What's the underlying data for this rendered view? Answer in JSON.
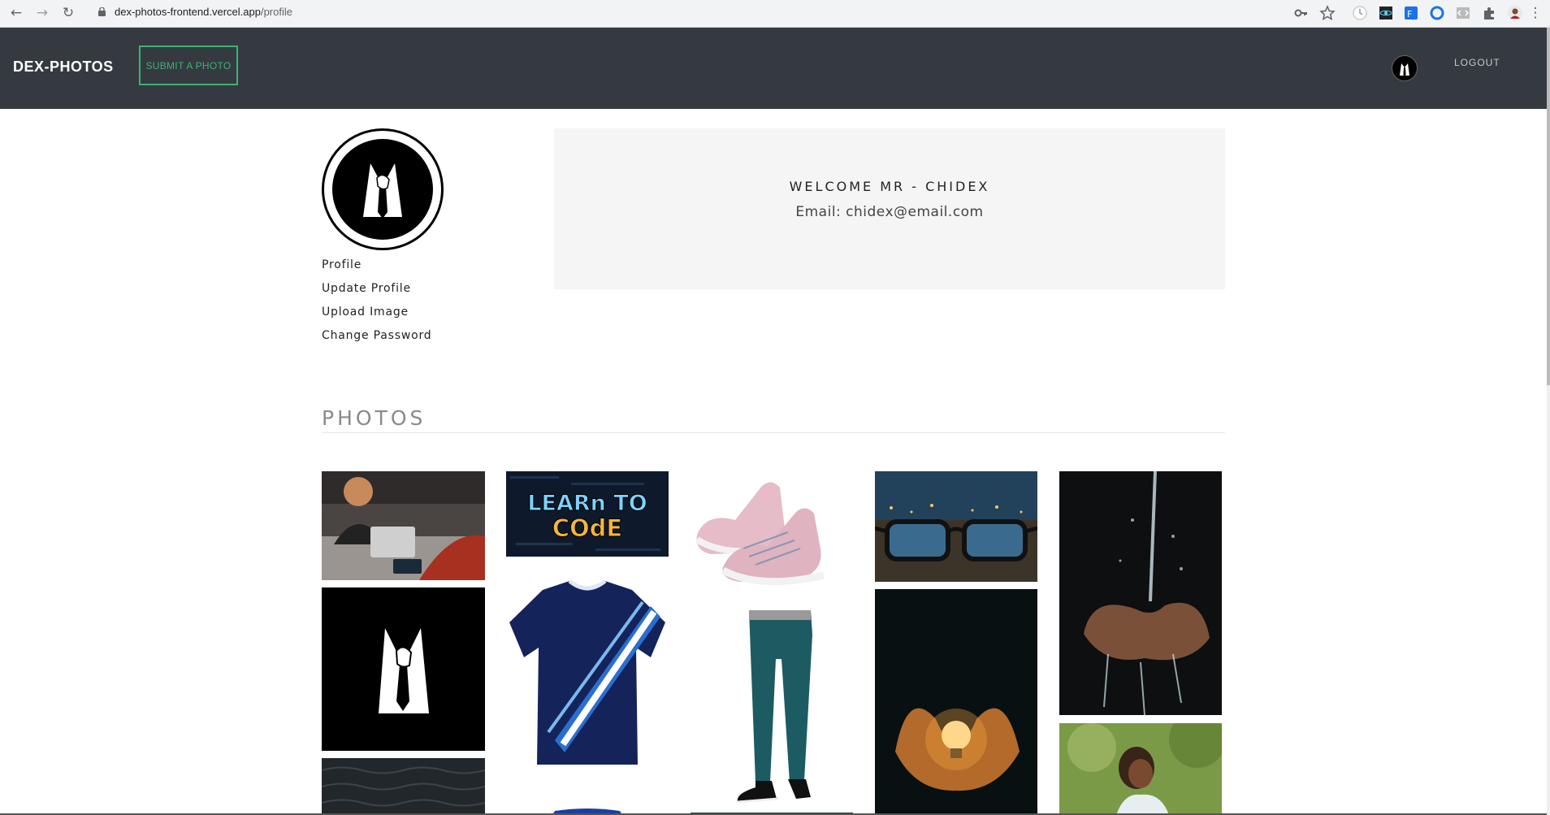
{
  "browser": {
    "url_host": "dex-photos-frontend.vercel.app",
    "url_path": "/profile"
  },
  "header": {
    "brand": "DEX-PHOTOS",
    "submit_label": "SUBMIT A PHOTO",
    "logout_label": "LOGOUT"
  },
  "profile": {
    "links": [
      "Profile",
      "Update Profile",
      "Upload Image",
      "Change Password"
    ],
    "welcome": "WELCOME MR - CHIDEX",
    "email": "Email: chidex@email.com"
  },
  "photos": {
    "title": "PHOTOS",
    "learn_to_code_text": "LEARn TO CODE"
  },
  "colors": {
    "navbar": "#343a40",
    "accent": "#3cb371",
    "welcome_bg": "#f5f5f6"
  }
}
